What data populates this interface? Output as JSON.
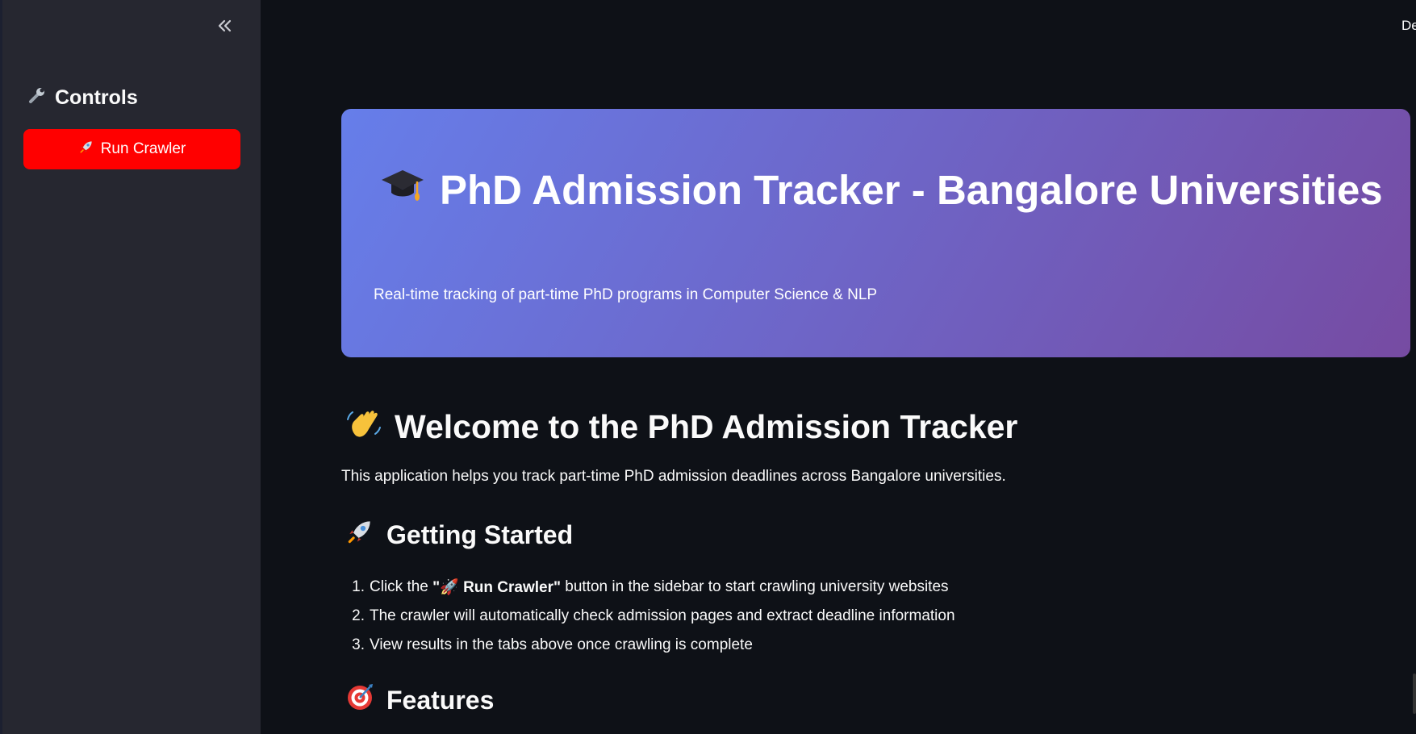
{
  "sidebar": {
    "collapse_icon": "chevrons-left-icon",
    "title_icon": "wrench-icon",
    "title": "Controls",
    "run_button": {
      "icon": "rocket-icon",
      "label": "Run Crawler",
      "color": "#ff0000"
    }
  },
  "header": {
    "deploy_partial": "De"
  },
  "hero": {
    "icon": "graduation-cap-icon",
    "title": "PhD Admission Tracker - Bangalore Universities",
    "subtitle": "Real-time tracking of part-time PhD programs in Computer Science & NLP",
    "gradient_start": "#667eea",
    "gradient_end": "#764ba2"
  },
  "welcome": {
    "icon": "waving-hand-icon",
    "title": "Welcome to the PhD Admission Tracker",
    "text": "This application helps you track part-time PhD admission deadlines across Bangalore universities."
  },
  "getting_started": {
    "icon": "rocket-icon",
    "title": "Getting Started",
    "steps": [
      {
        "num": "1.",
        "prefix": "Click the ",
        "bold": "\"🚀 Run Crawler\"",
        "suffix": " button in the sidebar to start crawling university websites"
      },
      {
        "num": "2.",
        "text": "The crawler will automatically check admission pages and extract deadline information"
      },
      {
        "num": "3.",
        "text": "View results in the tabs above once crawling is complete"
      }
    ]
  },
  "features": {
    "icon": "target-icon",
    "title": "Features"
  }
}
